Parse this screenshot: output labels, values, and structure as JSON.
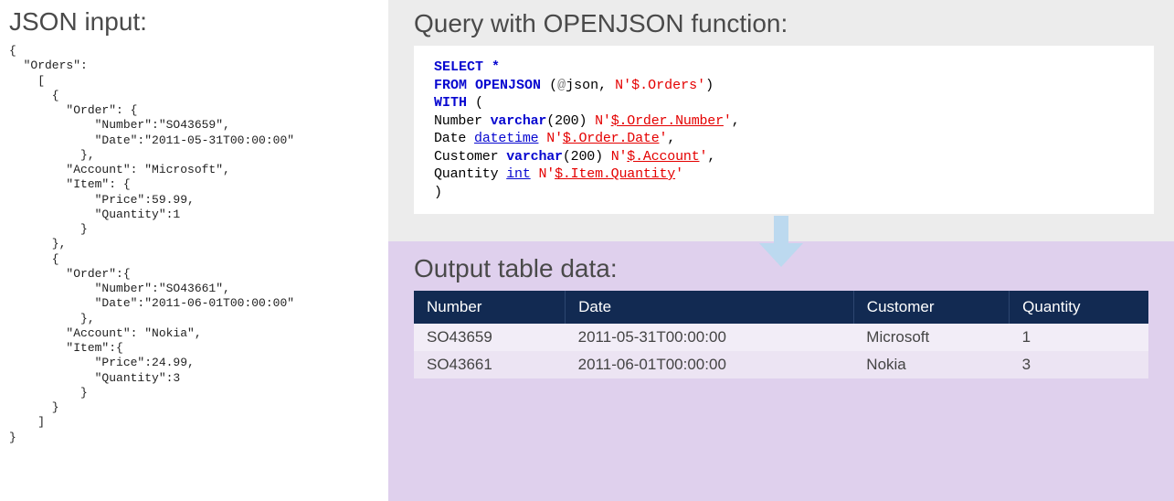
{
  "left": {
    "title": "JSON input:",
    "json_text": "{\n  \"Orders\":\n    [\n      {\n        \"Order\": {\n            \"Number\":\"SO43659\",\n            \"Date\":\"2011-05-31T00:00:00\"\n          },\n        \"Account\": \"Microsoft\",\n        \"Item\": {\n            \"Price\":59.99,\n            \"Quantity\":1\n          }\n      },\n      {\n        \"Order\":{\n            \"Number\":\"SO43661\",\n            \"Date\":\"2011-06-01T00:00:00\"\n          },\n        \"Account\": \"Nokia\",\n        \"Item\":{\n            \"Price\":24.99,\n            \"Quantity\":3\n          }\n      }\n    ]\n}"
  },
  "query": {
    "title": "Query with OPENJSON function:",
    "kw_select": "SELECT",
    "star": "*",
    "kw_from": "FROM",
    "kw_openjson": "OPENJSON",
    "paren_open": "(",
    "param_json_at": "@",
    "param_json": "json",
    "comma": ",",
    "path_orders": "N'$.Orders'",
    "paren_close": ")",
    "kw_with": "WITH",
    "col_number": "Number",
    "type_varchar": "varchar",
    "num200a": "200",
    "path_number": "N'$.Order.Number'",
    "col_date": "Date",
    "type_datetime": "datetime",
    "path_date": "N'$.Order.Date'",
    "col_customer": "Customer",
    "num200b": "200",
    "path_account": "N'$.Account'",
    "col_quantity": "Quantity",
    "type_int": "int",
    "path_quantity": "N'$.Item.Quantity'"
  },
  "output": {
    "title": "Output table data:",
    "headers": {
      "c0": "Number",
      "c1": "Date",
      "c2": "Customer",
      "c3": "Quantity"
    },
    "rows": [
      {
        "c0": "SO43659",
        "c1": "2011-05-31T00:00:00",
        "c2": "Microsoft",
        "c3": "1"
      },
      {
        "c0": "SO43661",
        "c1": "2011-06-01T00:00:00",
        "c2": "Nokia",
        "c3": "3"
      }
    ]
  }
}
